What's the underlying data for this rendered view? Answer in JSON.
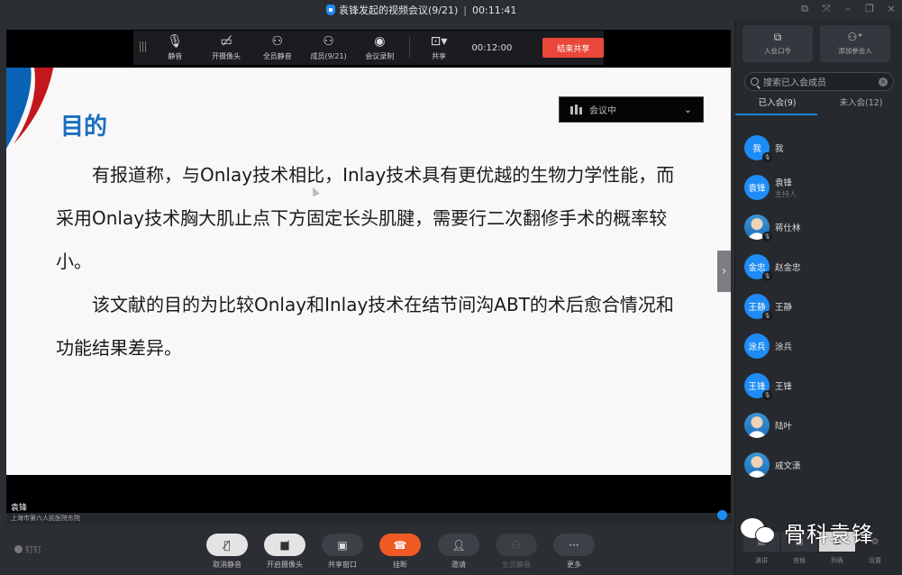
{
  "window": {
    "title": "袁锋发起的视频会议(9/21)",
    "elapsed": "00:11:41",
    "controls": [
      "restore-float",
      "fullscreen",
      "minimize",
      "maximize",
      "close"
    ]
  },
  "share_toolbar": {
    "items": [
      {
        "icon": "microphone-icon",
        "label": "静音"
      },
      {
        "icon": "camera-off-icon",
        "label": "开摄像头"
      },
      {
        "icon": "mute-all-icon",
        "label": "全员静音"
      },
      {
        "icon": "members-icon",
        "label": "成员(9/21)"
      },
      {
        "icon": "record-icon",
        "label": "会议录制"
      }
    ],
    "share": {
      "icon": "screen-share-icon",
      "label": "共享"
    },
    "timer": "00:12:00",
    "end_share_label": "结束共享"
  },
  "slide": {
    "heading": "目的",
    "paragraphs": [
      "有报道称，与Onlay技术相比，Inlay技术具有更优越的生物力学性能，而采用Onlay技术胸大肌止点下方固定长头肌腱，需要行二次翻修手术的概率较小。",
      "该文献的目的为比较Onlay和Inlay技术在结节间沟ABT的术后愈合情况和功能结果差异。"
    ]
  },
  "meeting_status": {
    "label": "会议中"
  },
  "speaker": {
    "name": "袁锋",
    "organization": "上海市第六人民医院东院"
  },
  "bottom_bar": {
    "brand": "钉钉",
    "buttons": [
      {
        "icon": "mic-muted-icon",
        "label": "取消静音",
        "style": "light"
      },
      {
        "icon": "camera-off-icon",
        "label": "开启摄像头",
        "style": "light"
      },
      {
        "icon": "share-window-icon",
        "label": "共享窗口",
        "style": "dark"
      },
      {
        "icon": "hang-up-icon",
        "label": "挂断",
        "style": "red"
      },
      {
        "icon": "invite-icon",
        "label": "邀请",
        "style": "dark"
      },
      {
        "icon": "mute-all-icon",
        "label": "全员静音",
        "style": "disabled"
      },
      {
        "icon": "more-icon",
        "label": "更多",
        "style": "dark"
      }
    ]
  },
  "sidebar": {
    "actions": [
      {
        "icon": "external-link-icon",
        "label": "入会口令"
      },
      {
        "icon": "add-person-icon",
        "label": "添加参会人"
      }
    ],
    "search_placeholder": "搜索已入会成员",
    "tabs": [
      {
        "label": "已入会(9)",
        "active": true
      },
      {
        "label": "未入会(12)",
        "active": false
      }
    ],
    "members": [
      {
        "avatar_text": "我",
        "name": "我",
        "role": "",
        "photo": false,
        "muted": true
      },
      {
        "avatar_text": "袁锋",
        "name": "袁锋",
        "role": "主持人",
        "photo": false,
        "muted": false
      },
      {
        "avatar_text": "",
        "name": "蒋仕林",
        "role": "",
        "photo": true,
        "muted": true
      },
      {
        "avatar_text": "金忠",
        "name": "赵金忠",
        "role": "",
        "photo": false,
        "muted": true
      },
      {
        "avatar_text": "王静",
        "name": "王静",
        "role": "",
        "photo": false,
        "muted": true
      },
      {
        "avatar_text": "涂兵",
        "name": "涂兵",
        "role": "",
        "photo": false,
        "muted": false
      },
      {
        "avatar_text": "王锋",
        "name": "王锋",
        "role": "",
        "photo": false,
        "muted": true
      },
      {
        "avatar_text": "",
        "name": "陆叶",
        "role": "",
        "photo": true,
        "muted": false
      },
      {
        "avatar_text": "",
        "name": "戚文潇",
        "role": "",
        "photo": true,
        "muted": false
      }
    ],
    "layout_buttons": [
      {
        "label": "演讲",
        "active": false
      },
      {
        "label": "宫格",
        "active": false
      },
      {
        "label": "列表",
        "active": true
      },
      {
        "label": "设置",
        "active": false
      }
    ]
  },
  "watermark": {
    "text": "骨科袁锋"
  },
  "colors": {
    "accent": "#1e8cf5",
    "end_share": "#e8473a",
    "hang_up": "#f05a23",
    "slide_heading": "#1a6fc0",
    "background": "#2b2e33"
  }
}
